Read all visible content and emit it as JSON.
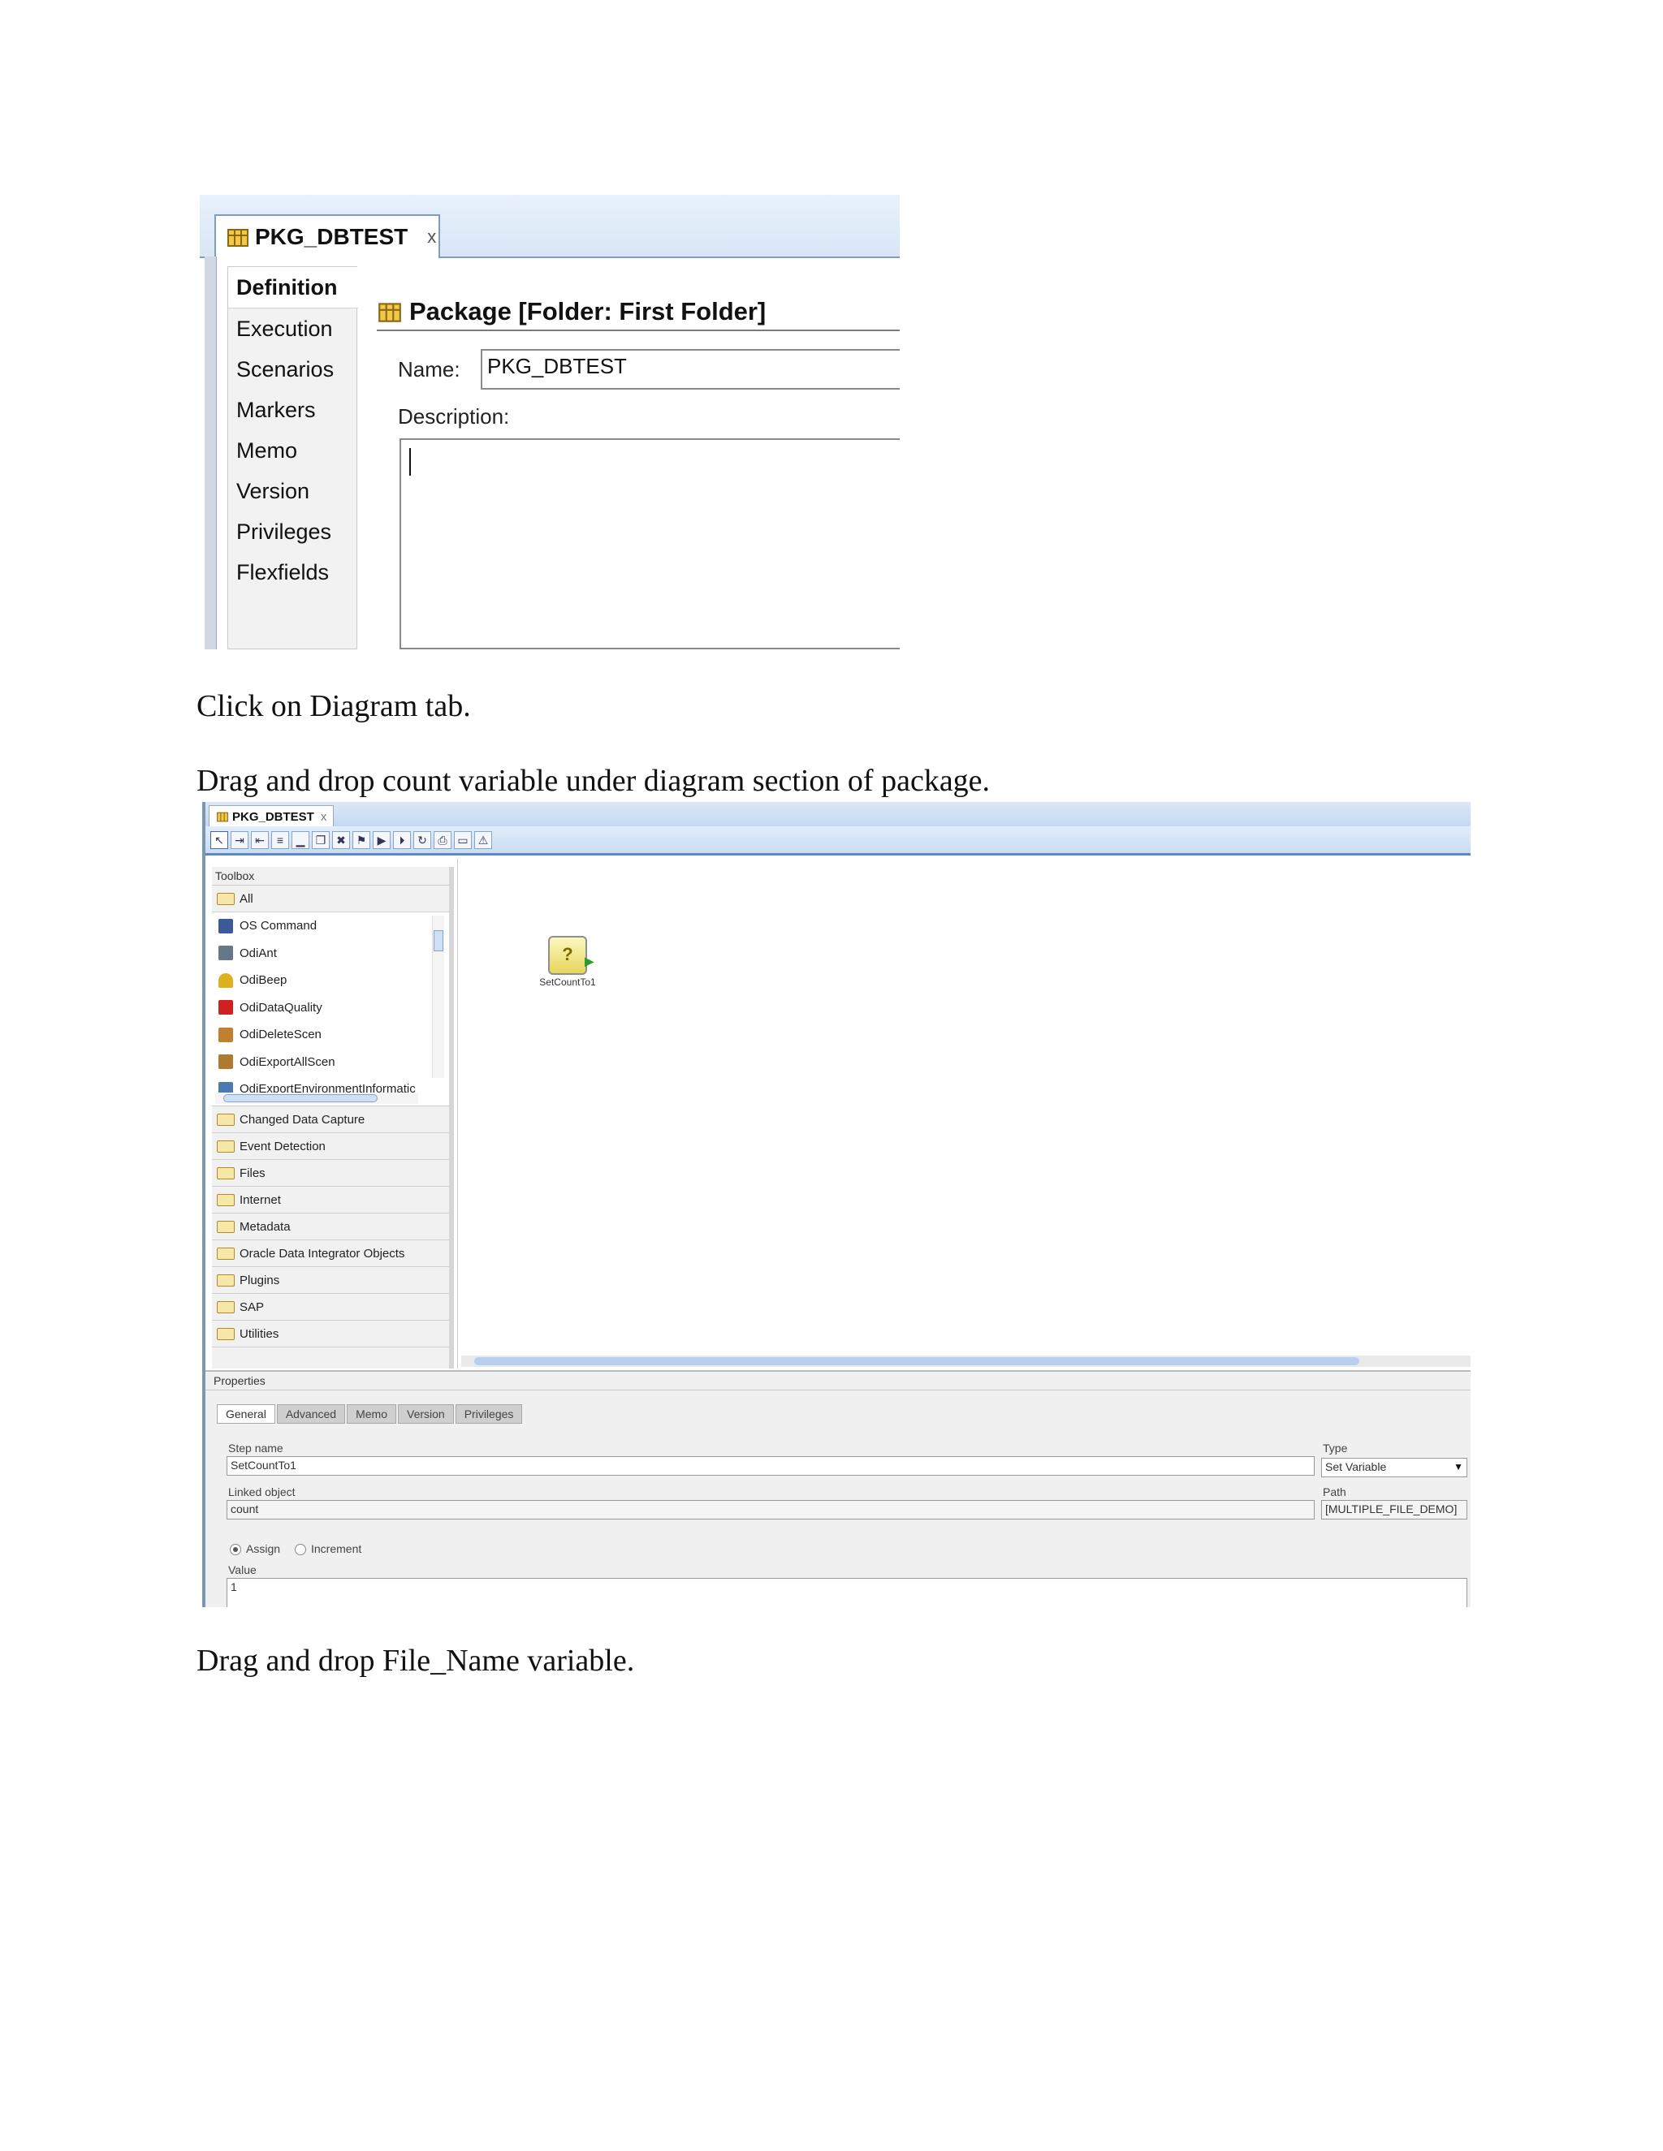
{
  "screenshot1": {
    "tab": {
      "title": "PKG_DBTEST",
      "close": "x"
    },
    "nav": [
      "Definition",
      "Execution",
      "Scenarios",
      "Markers",
      "Memo",
      "Version",
      "Privileges",
      "Flexfields"
    ],
    "panel_title": "Package [Folder: First Folder]",
    "name_label": "Name:",
    "name_value": "PKG_DBTEST",
    "description_label": "Description:"
  },
  "text": {
    "instruction1": "Click on Diagram tab.",
    "instruction2": "Drag and drop count variable under diagram section of package.",
    "instruction3": "Drag and drop File_Name variable."
  },
  "screenshot2": {
    "tab": {
      "title": "PKG_DBTEST",
      "close": "x"
    },
    "toolbox": {
      "title": "Toolbox",
      "all_folder": "All",
      "tools": [
        {
          "label": "OS Command",
          "color": "#3a5a9a"
        },
        {
          "label": "OdiAnt",
          "color": "#667788"
        },
        {
          "label": "OdiBeep",
          "color": "#e0b020"
        },
        {
          "label": "OdiDataQuality",
          "color": "#d02020"
        },
        {
          "label": "OdiDeleteScen",
          "color": "#c08030"
        },
        {
          "label": "OdiExportAllScen",
          "color": "#b07a30"
        },
        {
          "label": "OdiExportEnvironmentInformatic",
          "color": "#4a7ab0"
        }
      ],
      "folders": [
        "Changed Data Capture",
        "Event Detection",
        "Files",
        "Internet",
        "Metadata",
        "Oracle Data Integrator Objects",
        "Plugins",
        "SAP",
        "Utilities"
      ]
    },
    "canvas": {
      "step_label": "SetCountTo1"
    },
    "properties": {
      "title": "Properties",
      "tabs": [
        "General",
        "Advanced",
        "Memo",
        "Version",
        "Privileges"
      ],
      "step_name_label": "Step name",
      "step_name_value": "SetCountTo1",
      "type_label": "Type",
      "type_value": "Set Variable",
      "linked_object_label": "Linked object",
      "linked_object_value": "count",
      "path_label": "Path",
      "path_value": "[MULTIPLE_FILE_DEMO]",
      "assign_label": "Assign",
      "increment_label": "Increment",
      "value_label": "Value",
      "value_value": "1"
    }
  }
}
